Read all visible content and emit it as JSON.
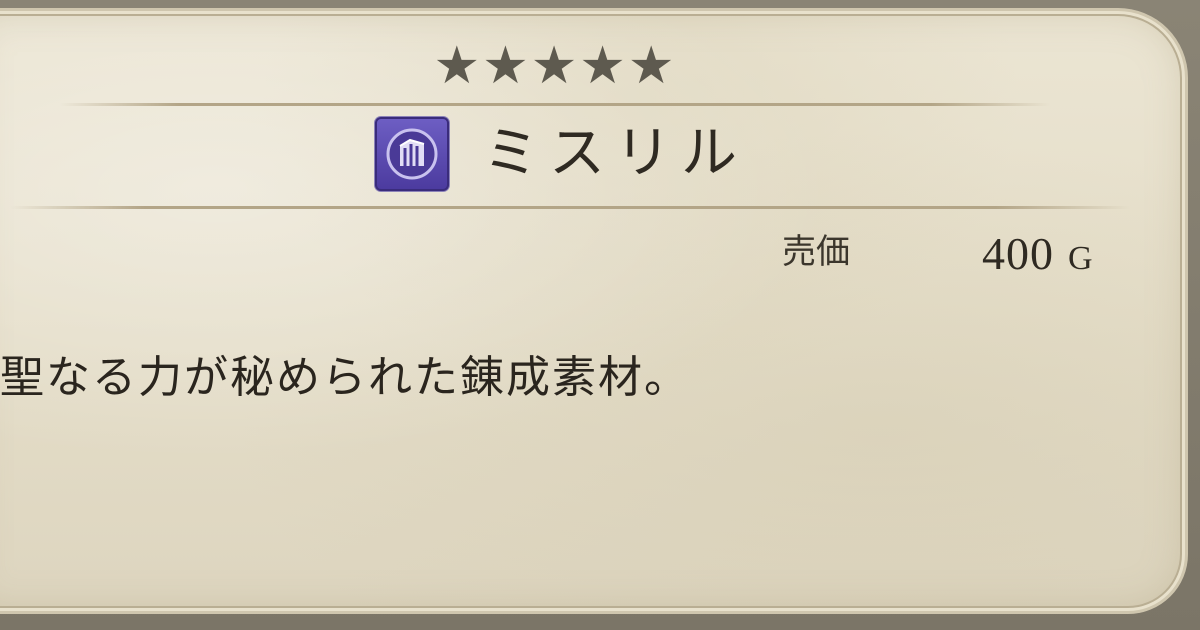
{
  "item": {
    "rarity_stars": "★★★★★",
    "rarity_level": 5,
    "rarity_max": 5,
    "icon": "mythril-crystal-icon",
    "name": "ミスリル",
    "price_label": "売価",
    "price_value": "400",
    "price_unit": "G",
    "description": "聖なる力が秘められた錬成素材。"
  },
  "colors": {
    "parchment": "#e5dec9",
    "ink": "#2f2a22",
    "star": "#5e5a4f",
    "icon_bg": "#5a4ab0"
  }
}
